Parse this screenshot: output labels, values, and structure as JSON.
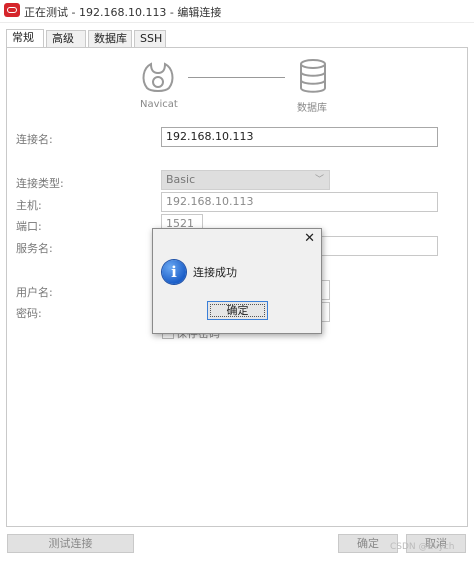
{
  "window": {
    "title": "正在测试 - 192.168.10.113 - 编辑连接"
  },
  "tabs": [
    "常规",
    "高级",
    "数据库",
    "SSH"
  ],
  "flow": {
    "left_label": "Navicat",
    "right_label": "数据库"
  },
  "form": {
    "connection_name": {
      "label": "连接名:",
      "value": "192.168.10.113"
    },
    "connection_type": {
      "label": "连接类型:",
      "value": "Basic"
    },
    "host": {
      "label": "主机:",
      "value": "192.168.10.113"
    },
    "port": {
      "label": "端口:",
      "value": "1521"
    },
    "service_name": {
      "label": "服务名:",
      "value": ""
    },
    "username": {
      "label": "用户名:",
      "value": ""
    },
    "password": {
      "label": "密码:",
      "value": ""
    },
    "save_password_label": "保存密码"
  },
  "buttons": {
    "test_connection": "测试连接",
    "ok": "确定",
    "cancel": "取消"
  },
  "dialog": {
    "message": "连接成功",
    "ok_label": "确定",
    "close_glyph": "✕",
    "info_glyph": "i"
  },
  "watermark": "CSDN @Evych",
  "colors": {
    "app_icon": "#d5252b",
    "info_icon": "#1c5fc9",
    "dialog_bg": "#f0f0f0"
  }
}
